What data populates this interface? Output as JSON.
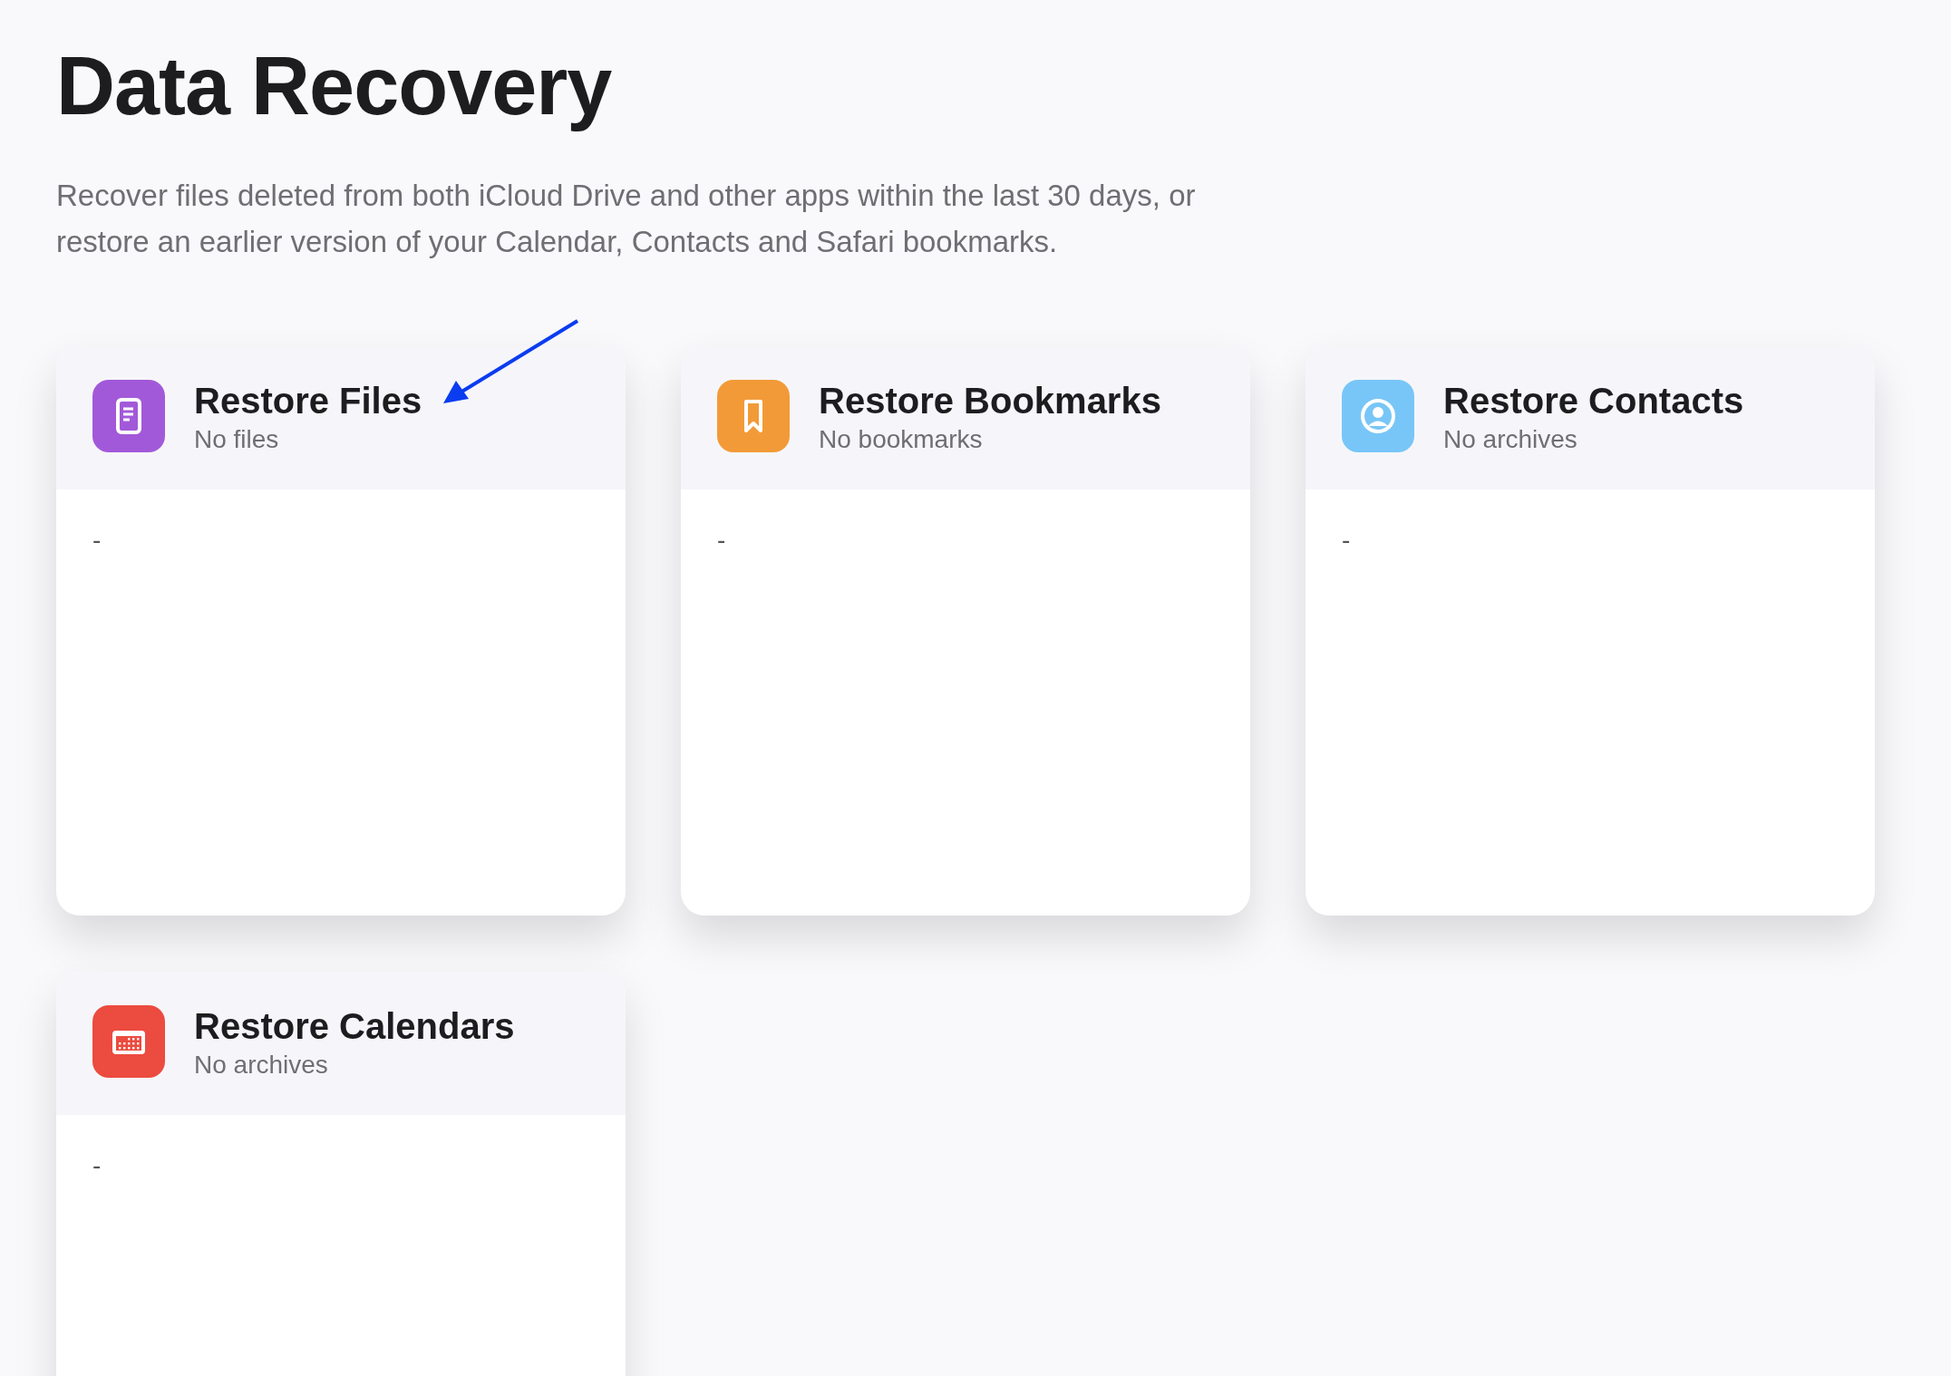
{
  "title": "Data Recovery",
  "description": "Recover files deleted from both iCloud Drive and other apps within the last 30 days, or restore an earlier version of your Calendar, Contacts and Safari bookmarks.",
  "cards": [
    {
      "kind": "files",
      "color": "#a259d9",
      "title": "Restore Files",
      "subtitle": "No files",
      "body": "-"
    },
    {
      "kind": "bookmarks",
      "color": "#f29a38",
      "title": "Restore Bookmarks",
      "subtitle": "No bookmarks",
      "body": "-"
    },
    {
      "kind": "contacts",
      "color": "#78c6f7",
      "title": "Restore Contacts",
      "subtitle": "No archives",
      "body": "-"
    },
    {
      "kind": "calendars",
      "color": "#ec4b3f",
      "title": "Restore Calendars",
      "subtitle": "No archives",
      "body": "-"
    }
  ]
}
